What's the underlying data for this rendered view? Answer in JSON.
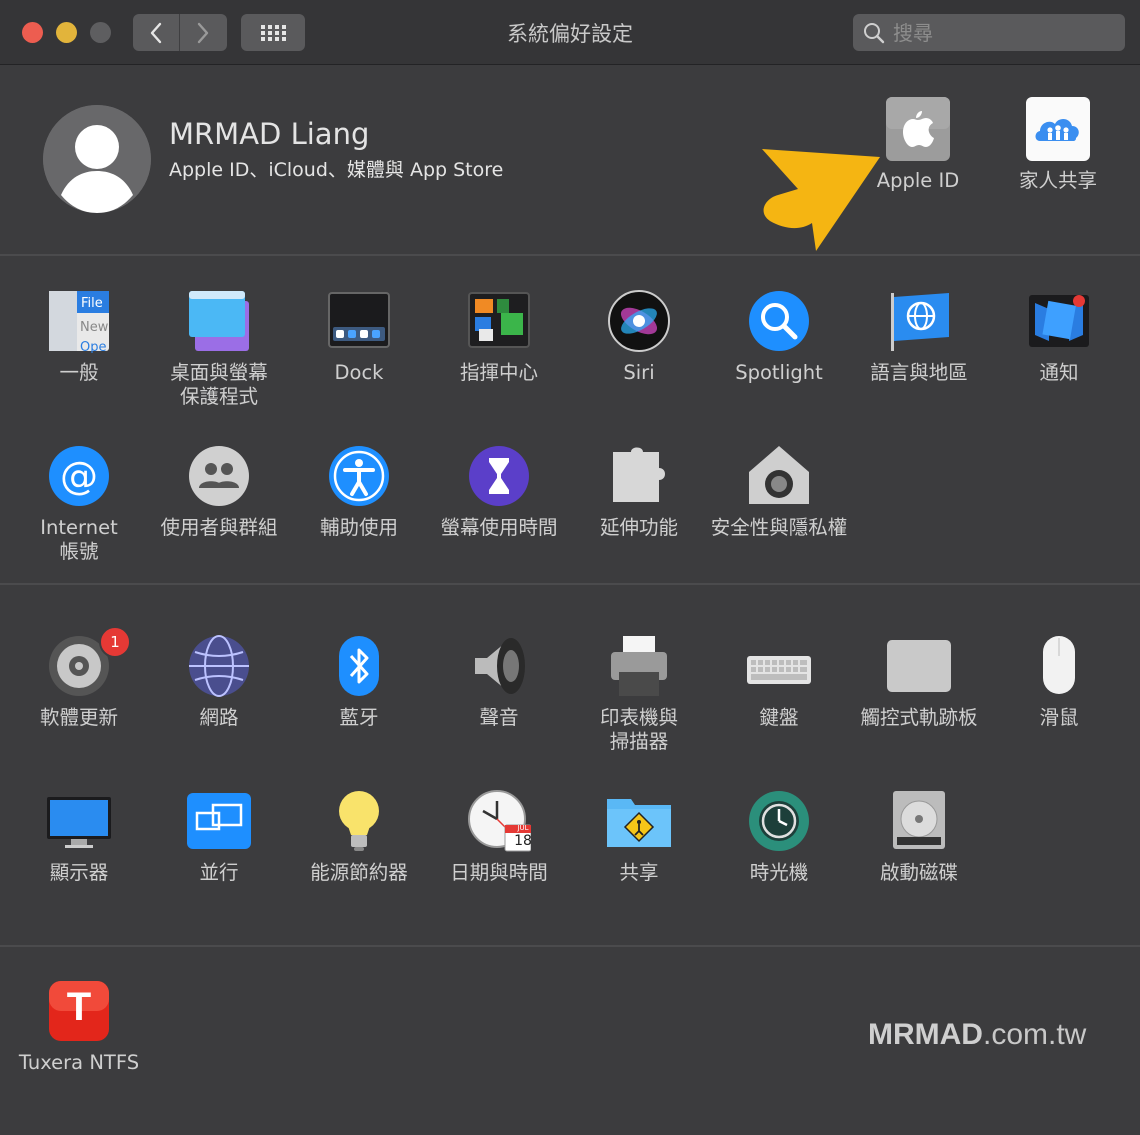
{
  "window": {
    "title": "系統偏好設定"
  },
  "toolbar": {
    "search_placeholder": "搜尋"
  },
  "account": {
    "name": "MRMAD Liang",
    "subtitle": "Apple ID、iCloud、媒體與 App Store",
    "apple_id_label": "Apple ID",
    "family_label": "家人共享"
  },
  "row1": [
    {
      "label": "一般",
      "icon": "general-icon"
    },
    {
      "label": "桌面與螢幕\n保護程式",
      "icon": "desktop-screensaver-icon"
    },
    {
      "label": "Dock",
      "icon": "dock-icon"
    },
    {
      "label": "指揮中心",
      "icon": "mission-control-icon"
    },
    {
      "label": "Siri",
      "icon": "siri-icon"
    },
    {
      "label": "Spotlight",
      "icon": "spotlight-icon"
    },
    {
      "label": "語言與地區",
      "icon": "language-region-icon"
    },
    {
      "label": "通知",
      "icon": "notifications-icon"
    }
  ],
  "row2": [
    {
      "label": "Internet\n帳號",
      "icon": "internet-accounts-icon"
    },
    {
      "label": "使用者與群組",
      "icon": "users-groups-icon"
    },
    {
      "label": "輔助使用",
      "icon": "accessibility-icon"
    },
    {
      "label": "螢幕使用時間",
      "icon": "screen-time-icon"
    },
    {
      "label": "延伸功能",
      "icon": "extensions-icon"
    },
    {
      "label": "安全性與隱私權",
      "icon": "security-privacy-icon"
    }
  ],
  "row3": [
    {
      "label": "軟體更新",
      "icon": "software-update-icon",
      "badge": "1"
    },
    {
      "label": "網路",
      "icon": "network-icon"
    },
    {
      "label": "藍牙",
      "icon": "bluetooth-icon"
    },
    {
      "label": "聲音",
      "icon": "sound-icon"
    },
    {
      "label": "印表機與\n掃描器",
      "icon": "printers-scanners-icon"
    },
    {
      "label": "鍵盤",
      "icon": "keyboard-icon"
    },
    {
      "label": "觸控式軌跡板",
      "icon": "trackpad-icon"
    },
    {
      "label": "滑鼠",
      "icon": "mouse-icon"
    }
  ],
  "row4": [
    {
      "label": "顯示器",
      "icon": "displays-icon"
    },
    {
      "label": "並行",
      "icon": "sidecar-icon"
    },
    {
      "label": "能源節約器",
      "icon": "energy-saver-icon"
    },
    {
      "label": "日期與時間",
      "icon": "date-time-icon",
      "cal_month": "JUL",
      "cal_day": "18"
    },
    {
      "label": "共享",
      "icon": "sharing-icon"
    },
    {
      "label": "時光機",
      "icon": "time-machine-icon"
    },
    {
      "label": "啟動磁碟",
      "icon": "startup-disk-icon"
    }
  ],
  "other": [
    {
      "label": "Tuxera NTFS",
      "icon": "tuxera-ntfs-icon",
      "glyph": "T"
    }
  ],
  "watermark": {
    "brand": "MRMAD",
    "domain": ".com.tw"
  },
  "colors": {
    "arrow": "#f5b512",
    "badge": "#e53935",
    "accent_blue": "#1e88e5"
  }
}
